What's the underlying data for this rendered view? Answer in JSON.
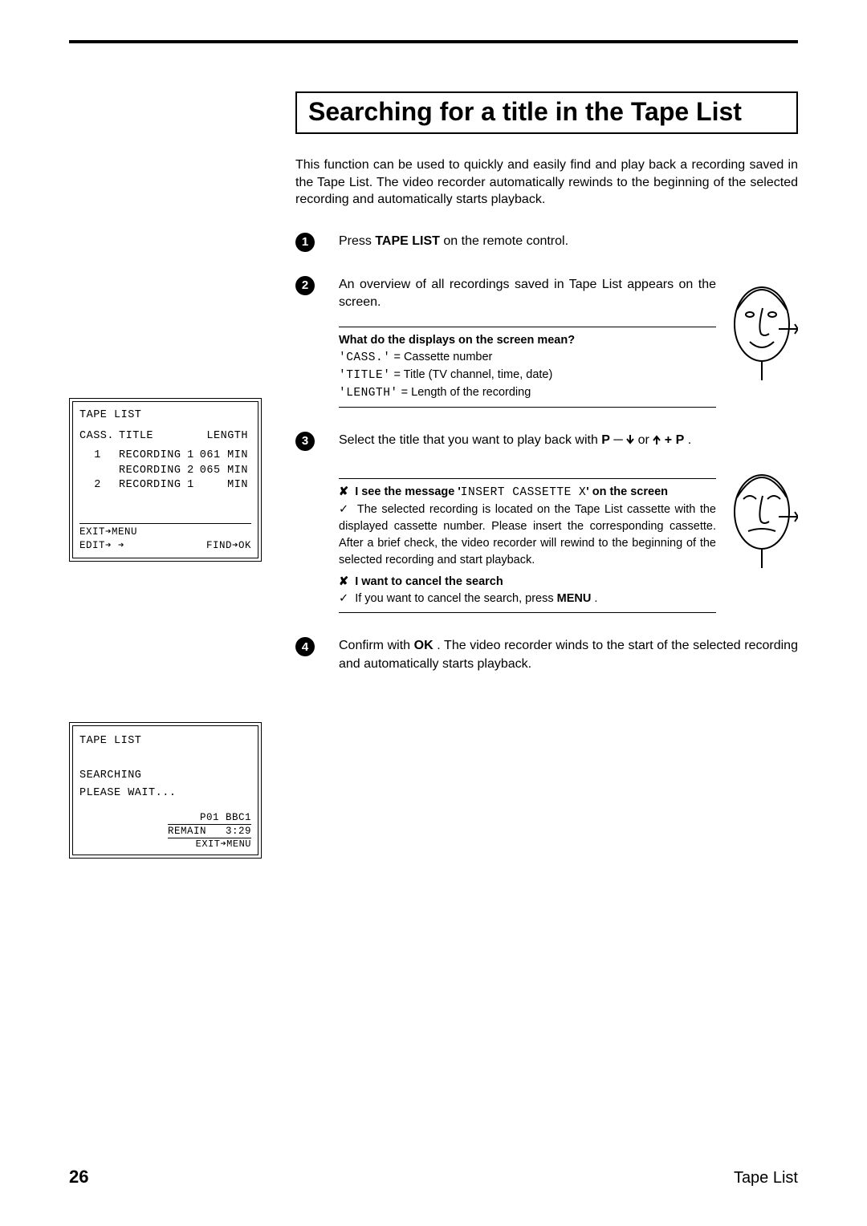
{
  "section_title": "Searching for a title in the Tape List",
  "intro": "This function can be used to quickly and easily find and play back a recording saved in the Tape List. The video recorder automatically rewinds to the beginning of the selected recording and automatically starts playback.",
  "steps": {
    "s1": {
      "num": "1",
      "pre": "Press ",
      "button": "TAPE LIST",
      "post": " on the remote control."
    },
    "s2": {
      "num": "2",
      "text": "An overview of all recordings saved in Tape List appears on the screen.",
      "infobox": {
        "q": "What do the displays on the screen mean?",
        "lines": {
          "l1_a": "'CASS.'",
          "l1_b": " = Cassette number",
          "l2_a": "'TITLE'",
          "l2_b": " = Title (TV channel, time, date)",
          "l3_a": "'LENGTH'",
          "l3_b": " = Length of the recording"
        }
      }
    },
    "s3": {
      "num": "3",
      "pre": "Select the title that you want to play back with ",
      "btn1": "P",
      "mid": " or ",
      "btn2": "P",
      "post": " .",
      "tips": {
        "t1_pre": "I see the message '",
        "t1_code": "INSERT CASSETTE X",
        "t1_post": "' on the screen",
        "t1_ans": "The selected recording is located on the Tape List cassette with the displayed cassette number. Please insert the corresponding cassette. After a brief check, the video recorder will rewind to the beginning of the selected recording and start playback.",
        "t2_q": "I want to cancel the search",
        "t2_pre": "If you want to cancel the search, press ",
        "t2_btn": "MENU",
        "t2_post": " ."
      }
    },
    "s4": {
      "num": "4",
      "pre": "Confirm with ",
      "button": "OK",
      "post": " . The video recorder winds to the start of the selected recording and automatically starts playback."
    }
  },
  "osd1": {
    "title": "TAPE LIST",
    "h_cass": "CASS.",
    "h_title": "TITLE",
    "h_length": "LENGTH",
    "rows": [
      {
        "c": "1",
        "t": "RECORDING",
        "n": "1",
        "len": "061 MIN"
      },
      {
        "c": "",
        "t": "RECORDING",
        "n": "2",
        "len": "065 MIN"
      },
      {
        "c": "2",
        "t": "RECORDING",
        "n": "1",
        "len": "    MIN"
      }
    ],
    "foot_left1": "EXIT➔MENU",
    "foot_left2": "EDIT➔ ➔",
    "foot_right": "FIND➔OK"
  },
  "osd2": {
    "title": "TAPE LIST",
    "line1": "SEARCHING",
    "line2": "PLEASE WAIT...",
    "ch": "P01 BBC1",
    "remain_label": "REMAIN",
    "remain_val": "3:29",
    "exit": "EXIT➔MENU"
  },
  "footer": {
    "page": "26",
    "section": "Tape List"
  }
}
